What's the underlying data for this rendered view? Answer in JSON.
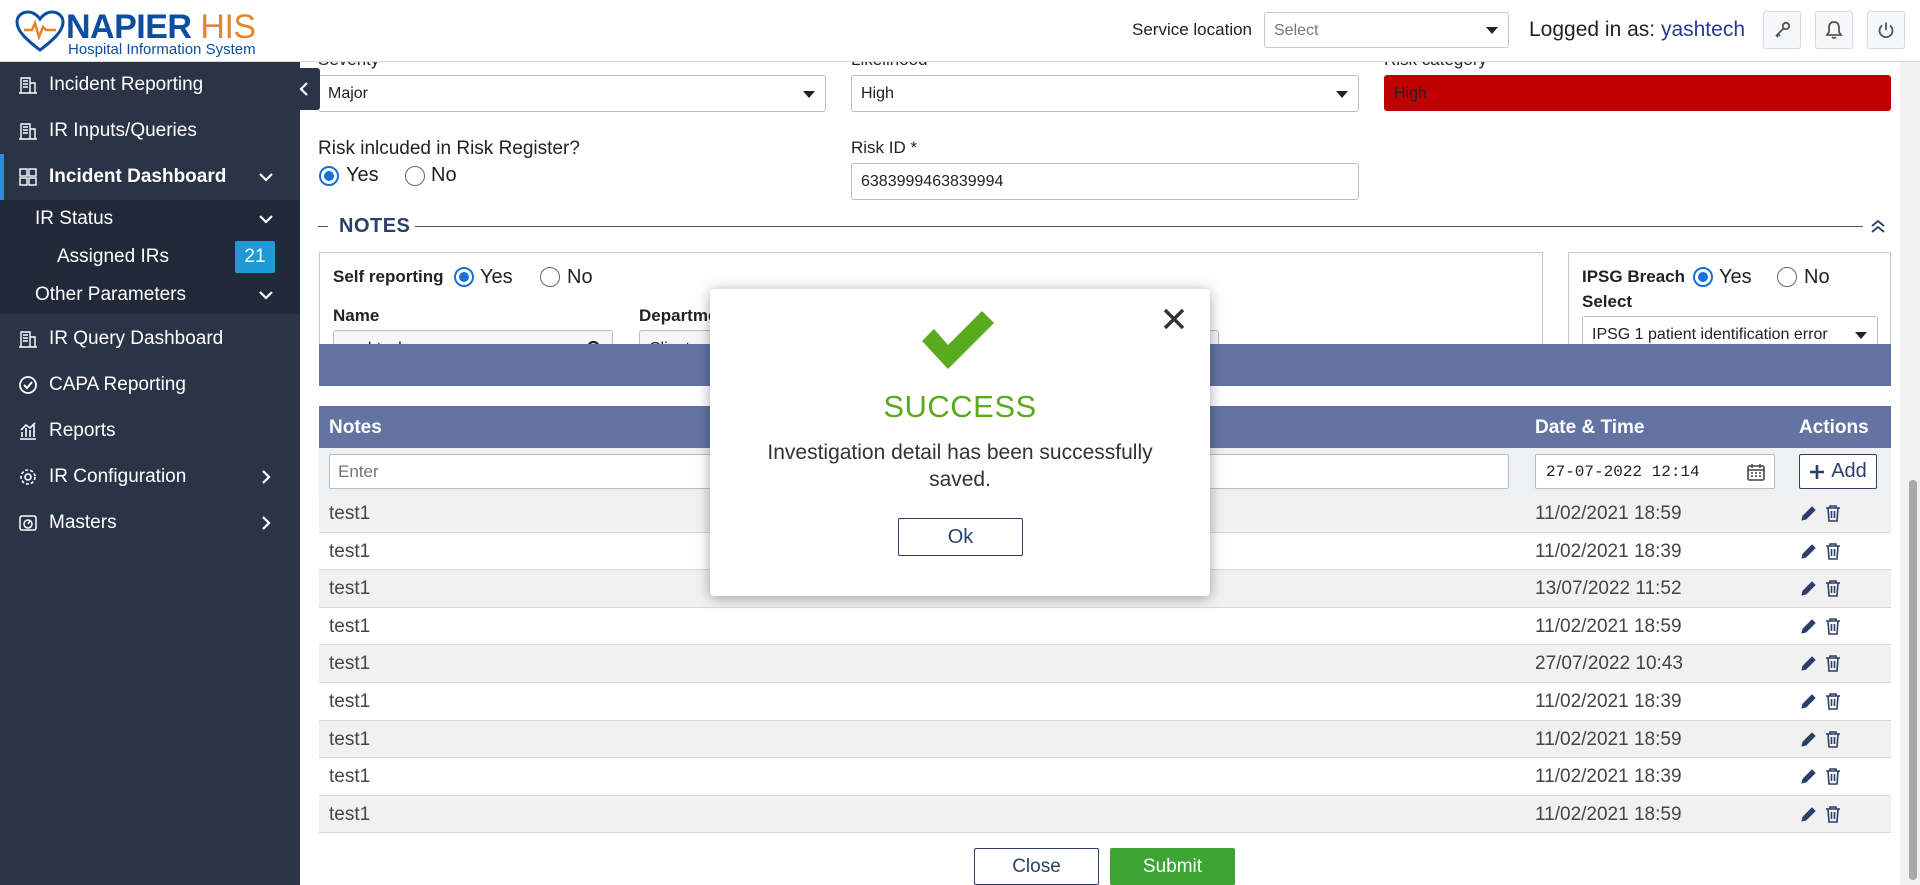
{
  "header": {
    "logo_name": "NAPIER",
    "logo_his": "HIS",
    "logo_sub": "Hospital Information System",
    "service_location_label": "Service location",
    "service_location_value": "Select",
    "logged_prefix": "Logged in as:",
    "logged_user": "yashtech"
  },
  "sidebar": {
    "items": [
      {
        "label": "Incident Reporting",
        "icon": "building-icon"
      },
      {
        "label": "IR Inputs/Queries",
        "icon": "building-icon"
      },
      {
        "label": "Incident Dashboard",
        "icon": "grid-icon"
      },
      {
        "label": "IR Status"
      },
      {
        "label": "Assigned IRs",
        "badge": "21"
      },
      {
        "label": "Other Parameters"
      },
      {
        "label": "IR Query Dashboard",
        "icon": "building-icon"
      },
      {
        "label": "CAPA Reporting",
        "icon": "check-circle-icon"
      },
      {
        "label": "Reports",
        "icon": "bar-chart-icon"
      },
      {
        "label": "IR Configuration",
        "icon": "gear-icon"
      },
      {
        "label": "Masters",
        "icon": "gauge-icon"
      }
    ]
  },
  "form": {
    "severity_label": "Severity",
    "severity_value": "Major",
    "likelihood_label": "Likelihood",
    "likelihood_value": "High",
    "risk_category_label": "Risk category",
    "risk_category_value": "High",
    "risk_register_label": "Risk inlcuded in Risk Register?",
    "yes": "Yes",
    "no": "No",
    "risk_id_label": "Risk ID *",
    "risk_id_value": "6383999463839994"
  },
  "notes_section": {
    "title": "NOTES",
    "self_reporting_label": "Self reporting",
    "name_label": "Name",
    "name_value": "yashtech",
    "department_label": "Departme",
    "department_value": "Client",
    "ipsg_label": "IPSG Breach",
    "select_label": "Select",
    "ipsg_value": "IPSG 1 patient identification error"
  },
  "table": {
    "col_notes": "Notes",
    "col_datetime": "Date & Time",
    "col_actions": "Actions",
    "input_placeholder": "Enter",
    "datetime_input": "27-07-2022 12:14",
    "add_label": "Add",
    "rows": [
      {
        "note": "test1",
        "datetime": "11/02/2021 18:59"
      },
      {
        "note": "test1",
        "datetime": "11/02/2021 18:39"
      },
      {
        "note": "test1",
        "datetime": "13/07/2022 11:52"
      },
      {
        "note": "test1",
        "datetime": "11/02/2021 18:59"
      },
      {
        "note": "test1",
        "datetime": "27/07/2022 10:43"
      },
      {
        "note": "test1",
        "datetime": "11/02/2021 18:39"
      },
      {
        "note": "test1",
        "datetime": "11/02/2021 18:59"
      },
      {
        "note": "test1",
        "datetime": "11/02/2021 18:39"
      },
      {
        "note": "test1",
        "datetime": "11/02/2021 18:59"
      }
    ]
  },
  "buttons": {
    "close": "Close",
    "submit": "Submit"
  },
  "modal": {
    "title": "SUCCESS",
    "message": "Investigation detail has been successfully saved.",
    "ok": "Ok"
  },
  "colors": {
    "sidebar_bg": "#2b3447",
    "table_header": "#6374a3",
    "risk_high": "#c00000",
    "success_green": "#5aaa1e",
    "submit_green": "#3ca534",
    "badge_blue": "#1f9ad6"
  }
}
